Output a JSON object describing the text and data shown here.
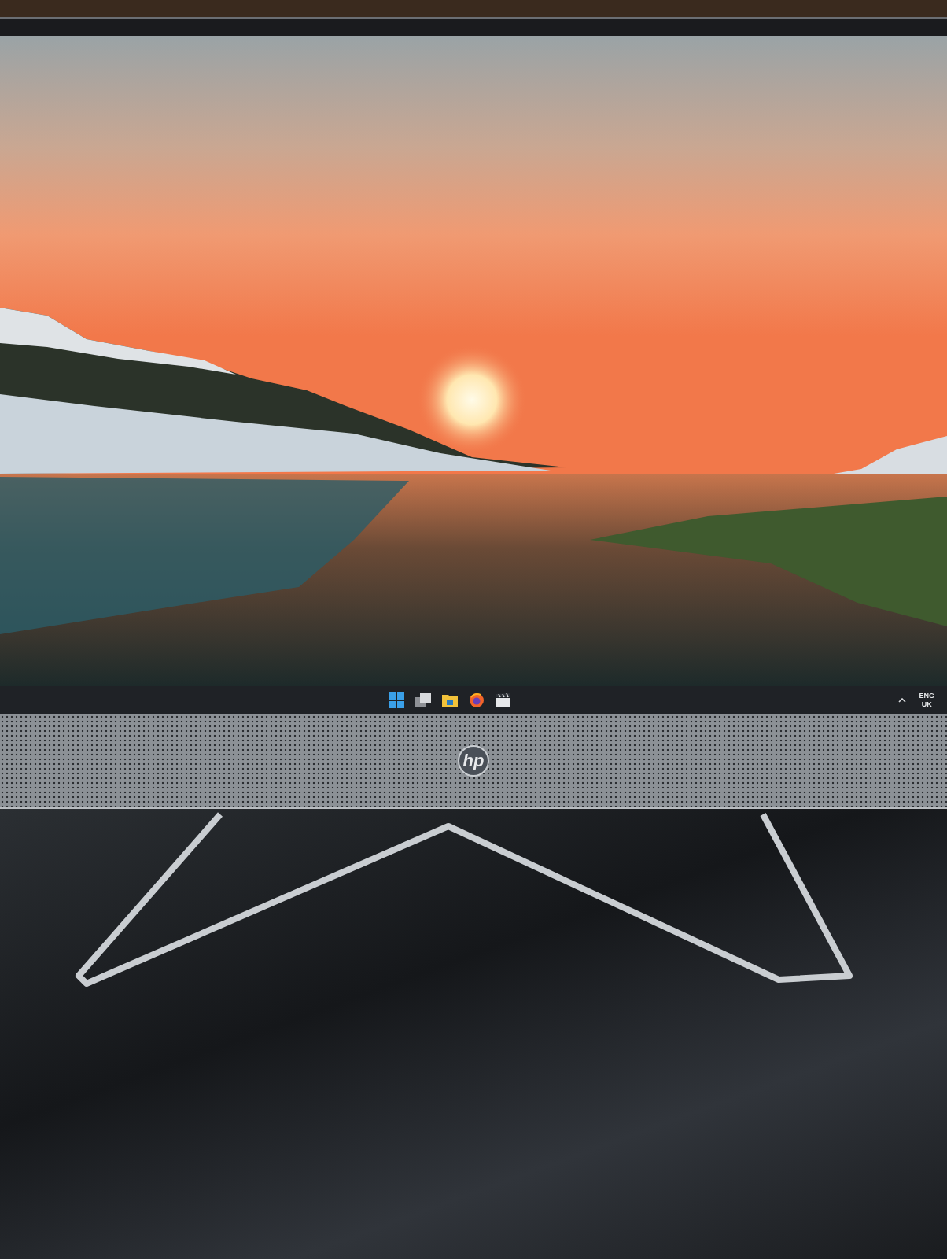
{
  "taskbar": {
    "language": "ENG",
    "region": "UK"
  },
  "monitor": {
    "logo": "hp"
  }
}
